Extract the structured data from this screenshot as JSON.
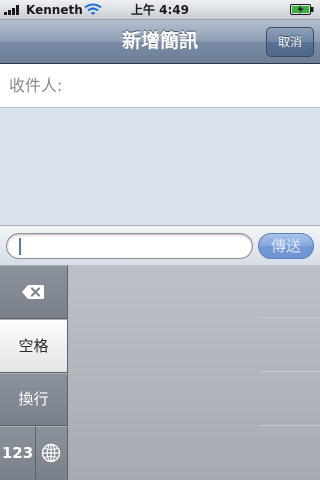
{
  "status_bar": {
    "carrier": "Kenneth",
    "time": "上午 4:49",
    "signal_bars": 4,
    "wifi": true,
    "battery": "charging"
  },
  "nav_bar": {
    "title": "新增簡訊",
    "cancel_label": "取消"
  },
  "recipient": {
    "label": "收件人:"
  },
  "compose": {
    "value": "",
    "send_label": "傳送"
  },
  "keyboard": {
    "delete_icon": "delete-backspace-icon",
    "space_label": "空格",
    "return_label": "換行",
    "numbers_label": "123",
    "globe_icon": "globe-icon"
  },
  "colors": {
    "nav_bar": "#7a8ca5",
    "send_button": "#7298d6",
    "message_background": "#dbe2ef",
    "battery_charging": "#3cb043"
  }
}
